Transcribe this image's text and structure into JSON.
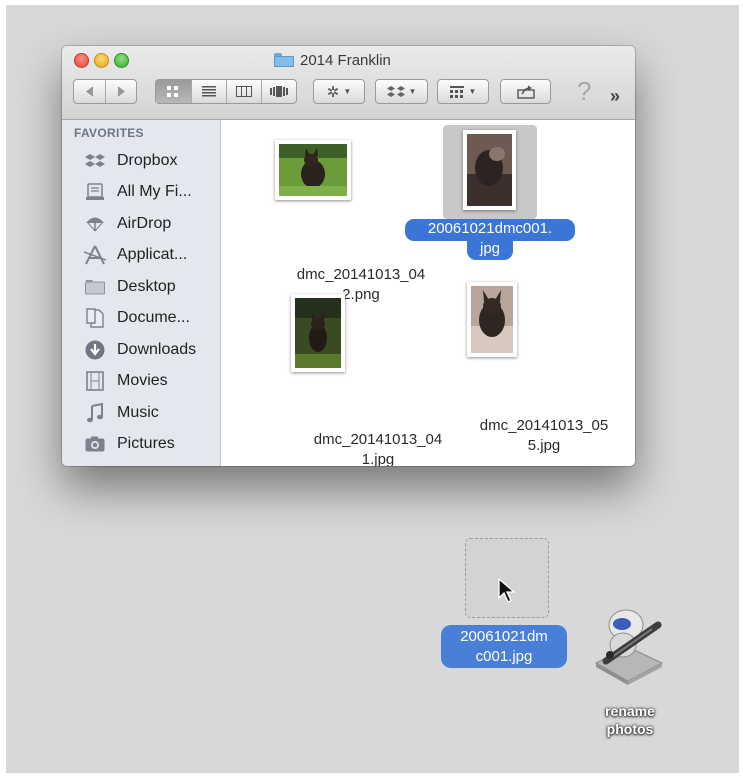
{
  "window": {
    "title": "2014 Franklin",
    "toolbar": {
      "back_icon": "chevron-left-icon",
      "forward_icon": "chevron-right-icon",
      "view_modes": [
        "icon-view-icon",
        "list-view-icon",
        "column-view-icon",
        "coverflow-view-icon"
      ],
      "active_view": "icon-view-icon",
      "action_icon": "gear-icon",
      "dropbox_icon": "dropbox-icon",
      "arrange_icon": "arrange-icon",
      "share_icon": "share-icon",
      "help_glyph": "?",
      "more_glyph": "»"
    }
  },
  "sidebar": {
    "heading": "FAVORITES",
    "items": [
      {
        "label": "Dropbox",
        "icon": "dropbox-icon"
      },
      {
        "label": "All My Fi...",
        "icon": "all-files-icon"
      },
      {
        "label": "AirDrop",
        "icon": "airdrop-icon"
      },
      {
        "label": "Applicat...",
        "icon": "applications-icon"
      },
      {
        "label": "Desktop",
        "icon": "desktop-folder-icon"
      },
      {
        "label": "Docume...",
        "icon": "documents-icon"
      },
      {
        "label": "Downloads",
        "icon": "downloads-icon"
      },
      {
        "label": "Movies",
        "icon": "movies-icon"
      },
      {
        "label": "Music",
        "icon": "music-icon"
      },
      {
        "label": "Pictures",
        "icon": "pictures-icon"
      }
    ]
  },
  "files": [
    {
      "name_line1": "dmc_20141013_04",
      "name_line2": "2.png",
      "selected": false
    },
    {
      "name_line1": "20061021dmc001.",
      "name_line2": "jpg",
      "selected": true
    },
    {
      "name_line1": "dmc_20141013_04",
      "name_line2": "1.jpg",
      "selected": false
    },
    {
      "name_line1": "dmc_20141013_05",
      "name_line2": "5.jpg",
      "selected": false
    }
  ],
  "drag": {
    "label_line1": "20061021dm",
    "label_line2": "c001.jpg"
  },
  "desktop_app": {
    "label_line1": "rename",
    "label_line2": "photos",
    "icon": "automator-robot-icon"
  },
  "colors": {
    "selection": "#3b75d6",
    "sidebar_bg": "#e4e8ee",
    "desktop_bg": "#d8d8d8"
  }
}
